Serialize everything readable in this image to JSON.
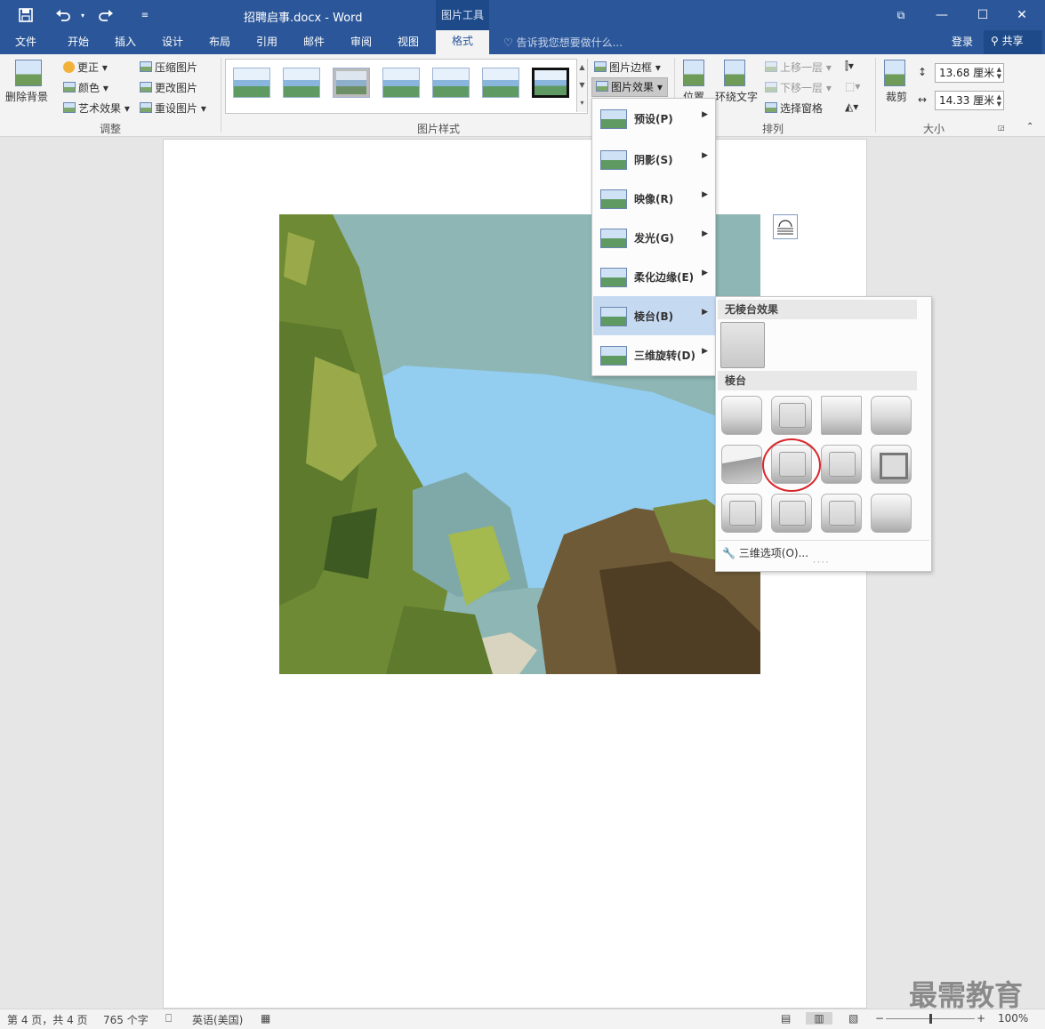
{
  "titlebar": {
    "doc_title": "招聘启事.docx - Word",
    "context_tab": "图片工具",
    "icons": [
      "save-icon",
      "undo-icon",
      "redo-icon",
      "customize-icon"
    ],
    "restore_glyph": "⧉",
    "minimize_glyph": "—",
    "maximize_glyph": "☐",
    "close_glyph": "✕"
  },
  "tabs": [
    "文件",
    "开始",
    "插入",
    "设计",
    "布局",
    "引用",
    "邮件",
    "审阅",
    "视图"
  ],
  "active_tab": "格式",
  "tell_me": "告诉我您想要做什么...",
  "account": {
    "login": "登录",
    "share": "共享"
  },
  "ribbon": {
    "adjust": {
      "remove_bg": "删除背景",
      "corrections": "更正",
      "color": "颜色",
      "artistic": "艺术效果",
      "compress": "压缩图片",
      "change": "更改图片",
      "reset": "重设图片",
      "label": "调整"
    },
    "styles": {
      "label": "图片样式",
      "border": "图片边框",
      "effects": "图片效果"
    },
    "arrange": {
      "position": "位置",
      "wrap": "环绕文字",
      "forward": "上移一层",
      "backward": "下移一层",
      "selection_pane": "选择窗格",
      "label": "排列"
    },
    "size": {
      "crop": "裁剪",
      "height": "13.68 厘米",
      "width": "14.33 厘米",
      "label": "大小"
    }
  },
  "effects_menu": [
    {
      "label": "预设(P)",
      "active": false
    },
    {
      "label": "阴影(S)",
      "active": false
    },
    {
      "label": "映像(R)",
      "active": false
    },
    {
      "label": "发光(G)",
      "active": false
    },
    {
      "label": "柔化边缘(E)",
      "active": false
    },
    {
      "label": "棱台(B)",
      "active": true
    },
    {
      "label": "三维旋转(D)",
      "active": false
    }
  ],
  "bevel_panel": {
    "no_bevel_header": "无棱台效果",
    "bevel_header": "棱台",
    "three_d_options": "三维选项(O)...",
    "selected_index": 5
  },
  "status": {
    "page": "第 4 页，共 4 页",
    "words": "765 个字",
    "language": "英语(美国)",
    "zoom": "100%",
    "zoom_slider": 0.5
  },
  "watermark": "最需教育",
  "colors": {
    "title_blue": "#2b579a",
    "selection_red": "#d9262c",
    "menu_highlight": "#c5d9f1"
  }
}
